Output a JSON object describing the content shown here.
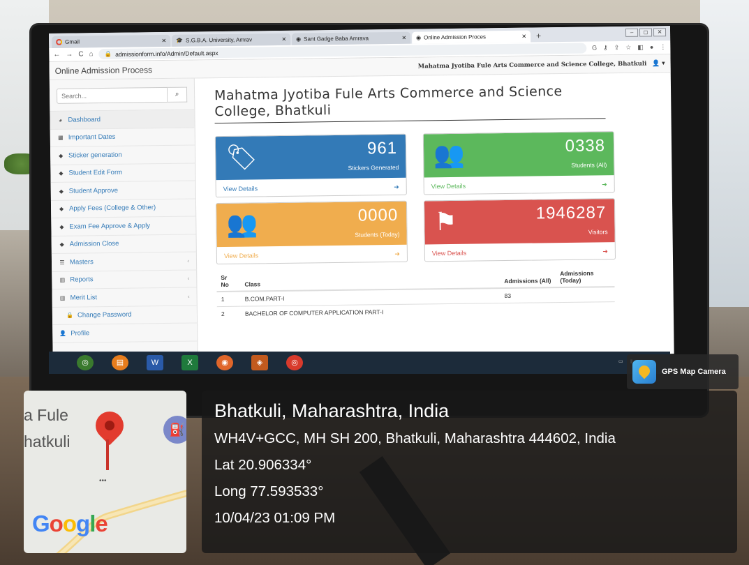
{
  "browser": {
    "tabs": [
      {
        "label": "Gmail",
        "active": false
      },
      {
        "label": "S.G.B.A. University, Amrav",
        "active": false
      },
      {
        "label": "Sant Gadge Baba Amrava",
        "active": false
      },
      {
        "label": "Online Admission Proces",
        "active": true
      }
    ],
    "url": "admissionform.info/Admin/Default.aspx"
  },
  "app": {
    "brand": "Online Admission Process",
    "college_header": "Mahatma Jyotiba Fule Arts Commerce and Science College, Bhatkuli"
  },
  "sidebar": {
    "search_placeholder": "Search...",
    "items": [
      {
        "label": "Dashboard",
        "icon": "dashboard-icon"
      },
      {
        "label": "Important Dates",
        "icon": "calendar-icon"
      },
      {
        "label": "Sticker generation",
        "icon": "tag-icon"
      },
      {
        "label": "Student Edit Form",
        "icon": "tag-icon"
      },
      {
        "label": "Student Approve",
        "icon": "tag-icon"
      },
      {
        "label": "Apply Fees (College & Other)",
        "icon": "tag-icon"
      },
      {
        "label": "Exam Fee Approve & Apply",
        "icon": "tag-icon"
      },
      {
        "label": "Admission Close",
        "icon": "tag-icon"
      },
      {
        "label": "Masters",
        "icon": "list-icon"
      },
      {
        "label": "Reports",
        "icon": "bar-chart-icon"
      },
      {
        "label": "Merit List",
        "icon": "bar-chart-icon"
      },
      {
        "label": "Change Password",
        "icon": "lock-icon"
      },
      {
        "label": "Profile",
        "icon": "user-icon"
      }
    ]
  },
  "main": {
    "title": "Mahatma Jyotiba Fule Arts Commerce and Science College, Bhatkuli",
    "cards": [
      {
        "value": "961",
        "label": "Stickers Generated",
        "link": "View Details",
        "icon": "tags-icon",
        "color": "#337ab7"
      },
      {
        "value": "0338",
        "label": "Students (All)",
        "link": "View Details",
        "icon": "users-icon",
        "color": "#5cb85c"
      },
      {
        "value": "0000",
        "label": "Students (Today)",
        "link": "View Details",
        "icon": "users-icon",
        "color": "#f0ad4e"
      },
      {
        "value": "1946287",
        "label": "Visitors",
        "link": "View Details",
        "icon": "flag-icon",
        "color": "#d9534f"
      }
    ],
    "table": {
      "headers": [
        "Sr No",
        "Class",
        "Admissions (All)",
        "Admissions (Today)"
      ],
      "rows": [
        [
          "1",
          "B.COM.PART-I",
          "83",
          ""
        ],
        [
          "2",
          "BACHELOR OF COMPUTER APPLICATION PART-I",
          "",
          ""
        ]
      ]
    }
  },
  "gps": {
    "app_name": "GPS Map Camera",
    "map_label_1": "a Fule",
    "map_label_2": "hatkuli",
    "map_brand": "Google",
    "city": "Bhatkuli, Maharashtra, India",
    "address": "WH4V+GCC, MH SH 200, Bhatkuli, Maharashtra 444602, India",
    "lat": "Lat 20.906334°",
    "long": "Long 77.593533°",
    "datetime": "10/04/23 01:09 PM"
  }
}
